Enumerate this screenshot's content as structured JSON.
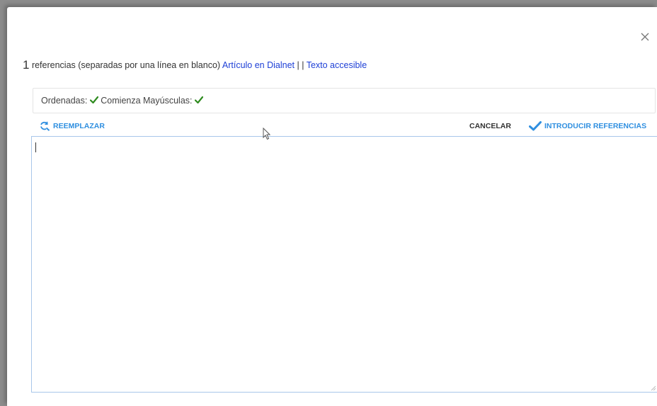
{
  "header": {
    "count": "1",
    "text": " referencias (separadas por una línea en blanco) ",
    "link_dialnet": "Artículo en Dialnet",
    "separator": " | | ",
    "link_accessible": "Texto accesible"
  },
  "status": {
    "ordered_label": "Ordenadas: ",
    "capital_label": " Comienza Mayúsculas: "
  },
  "toolbar": {
    "replace_label": "REEMPLAZAR",
    "cancel_label": "CANCELAR",
    "insert_label": "INTRODUCIR REFERENCIAS"
  },
  "editor": {
    "value": ""
  },
  "colors": {
    "accent": "#2f8fe0",
    "link": "#1d3fd6",
    "check": "#2e8b1f"
  },
  "icons": {
    "close": "close-icon",
    "replace": "refresh-search-icon",
    "insert": "checkmark-icon",
    "status_check": "checkmark-icon"
  }
}
